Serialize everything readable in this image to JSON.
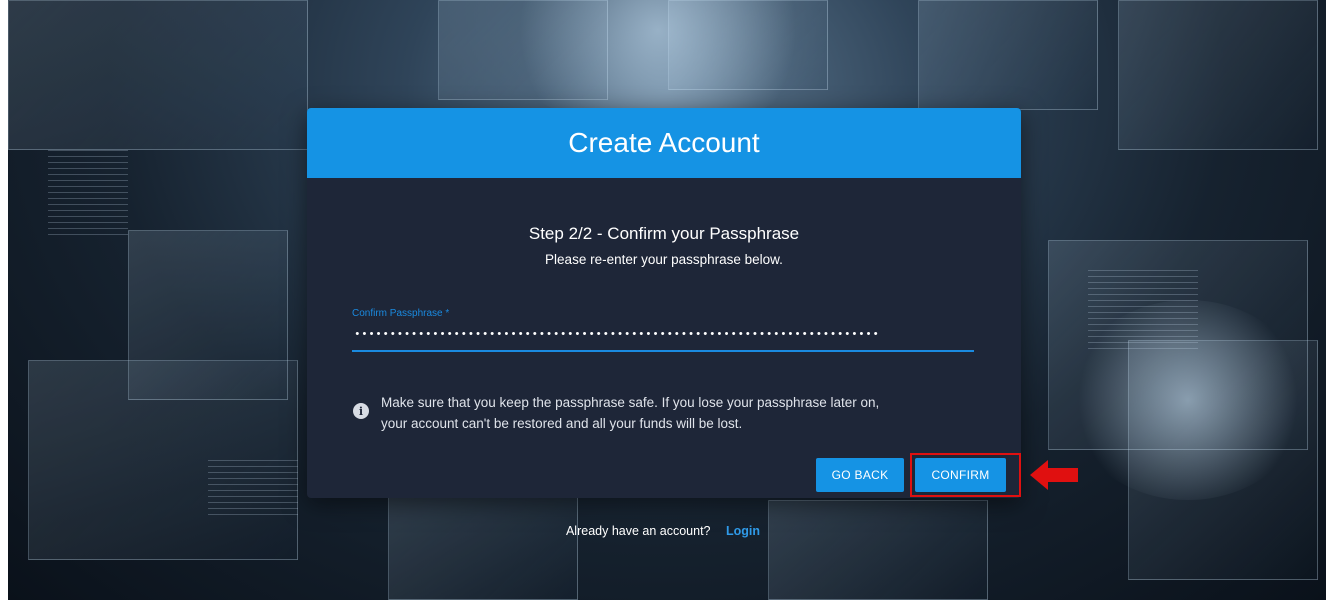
{
  "header": {
    "title": "Create Account"
  },
  "step": {
    "title": "Step 2/2 - Confirm your Passphrase",
    "subtitle": "Please re-enter your passphrase below."
  },
  "passphrase_field": {
    "label": "Confirm Passphrase *",
    "value": "••••••••••••••••••••••••••••••••••••••••••••••••••••••••••••••••••••••••••"
  },
  "notice": {
    "icon": "info-icon",
    "line1": "Make sure that you keep the passphrase safe. If you lose your passphrase later on,",
    "line2": "your account can't be restored and all your funds will be lost."
  },
  "buttons": {
    "back_label": "GO BACK",
    "confirm_label": "CONFIRM"
  },
  "footer": {
    "prompt": "Already have an account?",
    "login_label": "Login"
  },
  "colors": {
    "accent": "#1593e4",
    "card_background": "#1e2638",
    "highlight": "#e01010"
  }
}
